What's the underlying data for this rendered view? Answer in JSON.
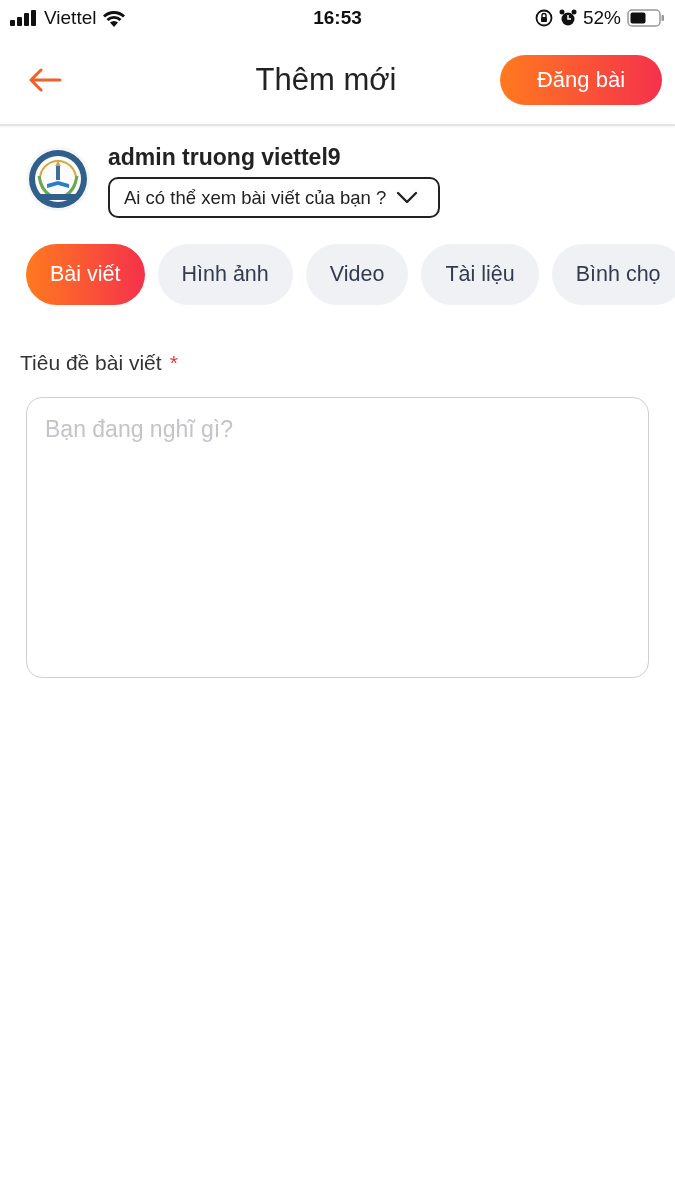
{
  "status_bar": {
    "carrier": "Viettel",
    "time": "16:53",
    "battery": "52%"
  },
  "header": {
    "title": "Thêm mới",
    "post_button": "Đăng bài"
  },
  "author": {
    "name": "admin truong viettel9",
    "audience_select": "Ai có thể xem bài viết của bạn ?"
  },
  "tabs": [
    {
      "label": "Bài viết",
      "selected": true
    },
    {
      "label": "Hình ảnh",
      "selected": false
    },
    {
      "label": "Video",
      "selected": false
    },
    {
      "label": "Tài liệu",
      "selected": false
    },
    {
      "label": "Bình chọ",
      "selected": false
    }
  ],
  "form": {
    "label": "Tiêu đề bài viết",
    "required_mark": "*",
    "placeholder": "Bạn đang nghĩ gì?"
  }
}
